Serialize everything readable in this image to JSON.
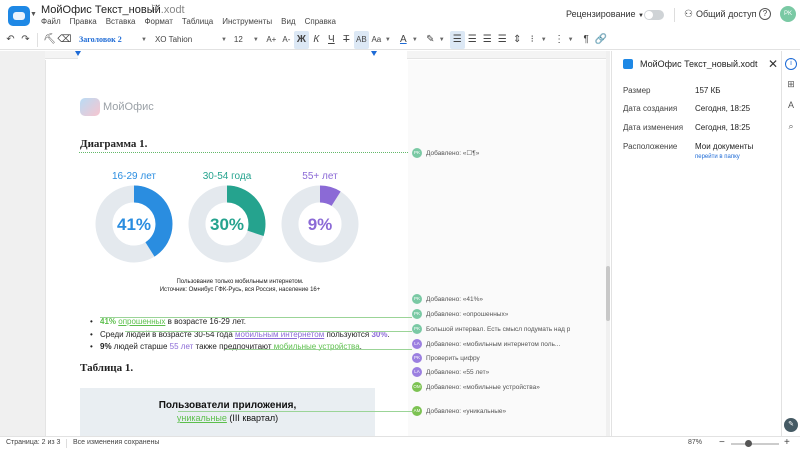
{
  "app": {
    "doc_title": "МойОфис Текст_новый",
    "doc_ext": ".xodt",
    "menu": [
      "Файл",
      "Правка",
      "Вставка",
      "Формат",
      "Таблица",
      "Инструменты",
      "Вид",
      "Справка"
    ],
    "review_label": "Рецензирование",
    "share_label": "Общий доступ",
    "user_initials": "PK"
  },
  "toolbar": {
    "style_value": "Заголовок 2",
    "font_value": "XO Tahion",
    "size_value": "12",
    "grow_label": "A+",
    "shrink_label": "A-",
    "bold_label": "Ж",
    "italic_label": "К",
    "underline_label": "Ч",
    "strike_label": "Т",
    "caps_label": "AB",
    "sub_label": "Aa",
    "color_label": "A"
  },
  "document": {
    "brand": "МойОфис",
    "heading_diagram": "Диаграмма 1.",
    "donuts": [
      {
        "label": "16-29 лет",
        "percent": 41,
        "value_text": "41%",
        "color": "#2a8de0"
      },
      {
        "label": "30-54 года",
        "percent": 30,
        "value_text": "30%",
        "color": "#25a38e"
      },
      {
        "label": "55+ лет",
        "percent": 9,
        "value_text": "9%",
        "color": "#8b6ad6"
      }
    ],
    "caption_line1": "Пользование только мобильным интернетом.",
    "caption_line2": "Источник: Омнибус ГФК-Русь, вся Россия, население 16+",
    "bullet1": {
      "num": "41%",
      "word": "опрошенных",
      "rest": " в возрасте 16-29 лет."
    },
    "bullet2": {
      "pre": "Среди людей в возрасте 30-54 года ",
      "link": "мобильным интернетом",
      "mid": " пользуются ",
      "num": "30%",
      "end": "."
    },
    "bullet3": {
      "num": "9%",
      "pre": " людей старше ",
      "age": "55 лет",
      "mid": " также предпочитают ",
      "tail": "мобильные устройства",
      "end": "."
    },
    "heading_table": "Таблица 1.",
    "table_title": "Пользователи приложения,",
    "table_sub_word": "уникальные",
    "table_sub_rest": " (III квартал)"
  },
  "comments": [
    {
      "initials": "PK",
      "text": "Добавлено: «☐¶»",
      "color": "#7ac9a4"
    },
    {
      "initials": "PK",
      "text": "Добавлено: «41%»",
      "color": "#7ac9a4"
    },
    {
      "initials": "PK",
      "text": "Добавлено: «опрошенных»",
      "color": "#7ac9a4"
    },
    {
      "initials": "PK",
      "text": "Большой интервал. Есть смысл подумать над р",
      "color": "#7ac9a4"
    },
    {
      "initials": "LA",
      "text": "Добавлено: «мобильным интернетом поль...",
      "color": "#9b7fe0"
    },
    {
      "initials": "PK",
      "text": "Проверить цифру",
      "color": "#9b7fe0"
    },
    {
      "initials": "LA",
      "text": "Добавлено: «55 лет»",
      "color": "#9b7fe0"
    },
    {
      "initials": "ОМ",
      "text": "Добавлено: «мобильные устройства»",
      "color": "#7cc252"
    },
    {
      "initials": "AM",
      "text": "Добавлено: «уникальные»",
      "color": "#7cc252"
    }
  ],
  "info_panel": {
    "title": "МойОфис Текст_новый.xodt",
    "size_label": "Размер",
    "size_value": "157 КБ",
    "created_label": "Дата создания",
    "created_value": "Сегодня, 18:25",
    "modified_label": "Дата изменения",
    "modified_value": "Сегодня, 18:25",
    "location_label": "Расположение",
    "location_value": "Мои документы",
    "location_link": "перейти в папку"
  },
  "status": {
    "pages": "Страница: 2 из 3",
    "saved": "Все изменения сохранены",
    "zoom": "87%"
  }
}
